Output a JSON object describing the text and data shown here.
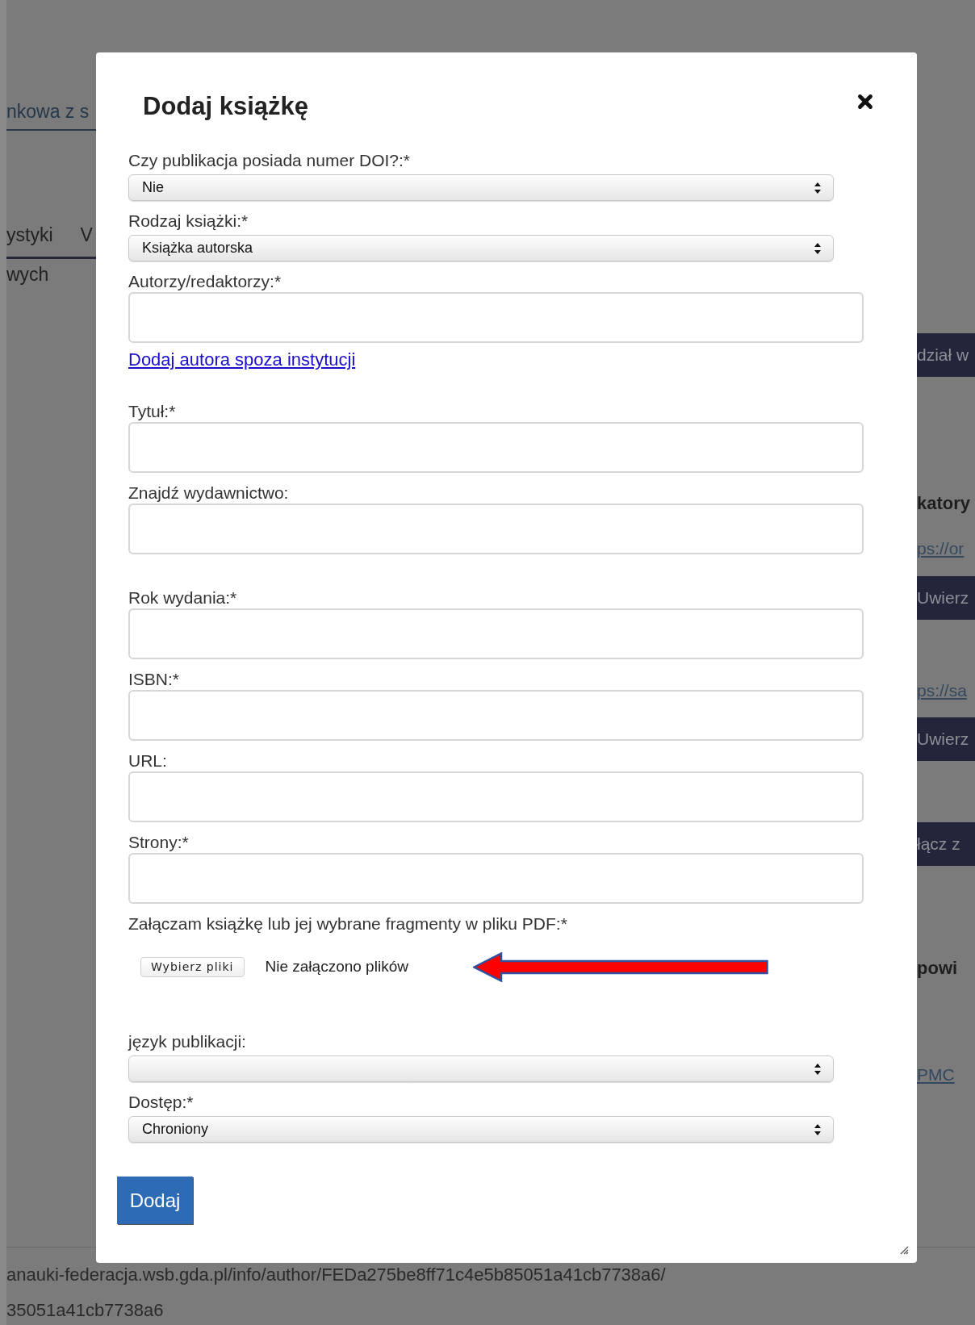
{
  "background": {
    "left_items": [
      {
        "kind": "link",
        "text": "nkowa z s"
      },
      {
        "kind": "tabs",
        "texts": [
          "ystyki",
          "V"
        ]
      },
      {
        "kind": "text",
        "text": "wych"
      }
    ],
    "right_items": [
      {
        "kind": "button",
        "text": "dział w"
      },
      {
        "kind": "heading",
        "text": "katory"
      },
      {
        "kind": "link",
        "text": "ps://or"
      },
      {
        "kind": "button",
        "text": "Uwierz"
      },
      {
        "kind": "link",
        "text": "ps://sa"
      },
      {
        "kind": "button",
        "text": "Uwierz"
      },
      {
        "kind": "button",
        "text": "łącz z"
      },
      {
        "kind": "heading",
        "text": "powi"
      },
      {
        "kind": "link",
        "text": "PMC"
      }
    ],
    "footer_lines": [
      "anauki-federacja.wsb.gda.pl/info/author/FEDa275be8ff71c4e5b85051a41cb7738a6/",
      "35051a41cb7738a6"
    ]
  },
  "dialog": {
    "title": "Dodaj książkę",
    "fields": [
      {
        "kind": "select",
        "label": "Czy publikacja posiada numer DOI?:*",
        "value": "Nie"
      },
      {
        "kind": "select",
        "label": "Rodzaj książki:*",
        "value": "Książka autorska"
      },
      {
        "kind": "text",
        "label": "Autorzy/redaktorzy:*"
      },
      {
        "kind": "link",
        "text": "Dodaj autora spoza instytucji"
      },
      {
        "kind": "text",
        "label": "Tytuł:*"
      },
      {
        "kind": "search",
        "label": "Znajdź wydawnictwo:"
      },
      {
        "kind": "text",
        "label": "Rok wydania:*"
      },
      {
        "kind": "text",
        "label": "ISBN:*"
      },
      {
        "kind": "text",
        "label": "URL:"
      },
      {
        "kind": "text",
        "label": "Strony:*"
      },
      {
        "kind": "file",
        "label": "Załączam książkę lub jej wybrane fragmenty w pliku PDF:*",
        "button": "Wybierz pliki",
        "status": "Nie załączono plików"
      },
      {
        "kind": "select",
        "label": "język publikacji:"
      },
      {
        "kind": "select",
        "label": "Dostęp:*",
        "value": "Chroniony"
      }
    ],
    "submit": "Dodaj"
  }
}
